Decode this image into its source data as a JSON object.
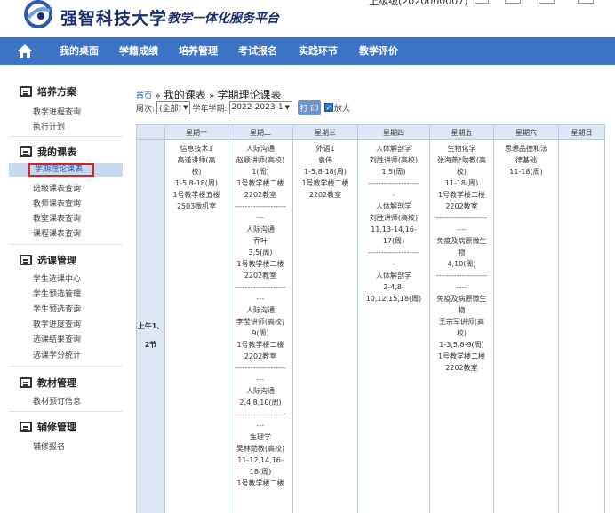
{
  "header": {
    "school_name": "强智科技大学",
    "platform_name": "教学一体化服务平台",
    "user_info": "上级级(2020000007)"
  },
  "nav": {
    "items": [
      "我的桌面",
      "学籍成绩",
      "培养管理",
      "考试报名",
      "实践环节",
      "教学评价"
    ]
  },
  "sidebar": {
    "sections": [
      {
        "title": "培养方案",
        "items": [
          "教学进程查询",
          "执行计划"
        ]
      },
      {
        "title": "我的课表",
        "items": [
          "学期理论课表",
          "班级课表查询",
          "教师课表查询",
          "教室课表查询",
          "课程课表查询"
        ]
      },
      {
        "title": "选课管理",
        "items": [
          "学生选课中心",
          "学生预选管理",
          "学生预选查询",
          "教学进度查询",
          "选课结果查询",
          "选课学分统计"
        ]
      },
      {
        "title": "教材管理",
        "items": [
          "教材预订信息"
        ]
      },
      {
        "title": "辅修管理",
        "items": [
          "辅修报名"
        ]
      }
    ]
  },
  "breadcrumb": {
    "home": "首页",
    "sep": "»",
    "level1": "我的课表",
    "level2": "学期理论课表"
  },
  "filters": {
    "week_label": "周次:",
    "week_value": "(全部)",
    "term_label": "学年学期:",
    "term_value": "2022-2023-1",
    "print_label": "打 印",
    "zoom_label": "放大"
  },
  "timetable": {
    "days": [
      "星期一",
      "星期二",
      "星期三",
      "星期四",
      "星期五",
      "星期六",
      "星期日"
    ],
    "period_label_1": "上午1、",
    "period_label_2": "2节",
    "monday": [
      "信息技术1",
      "高谨讲师(高",
      "校)",
      "1-5,8-18(周)",
      "1号教学楼五楼",
      "2503微机室"
    ],
    "tuesday": [
      "人际沟通",
      "赵颖讲师(高校)",
      "1(周)",
      "1号教学楼二楼",
      "2202教室",
      "--------------------",
      "---",
      "人际沟通",
      "乔叶",
      "3,5(周)",
      "1号教学楼二楼",
      "2202教室",
      "--------------------",
      "---",
      "人际沟通",
      "李莹讲师(高校)",
      "9(周)",
      "1号教学楼二楼",
      "2202教室",
      "--------------------",
      "---",
      "人际沟通",
      "2,4,8,10(周)",
      "--------------------",
      "---",
      "生理学",
      "吴林助教(高校)",
      "11-12,14,16-",
      "18(周)",
      "1号教学楼二楼"
    ],
    "wednesday": [
      "外语1",
      "袁伟",
      "1-5,8-18(周)",
      "1号教学楼二楼",
      "2202教室"
    ],
    "thursday": [
      "人体解剖学",
      "刘胜讲师(高校)",
      "1,5(周)",
      "--------------------",
      "-",
      "人体解剖学",
      "刘胜讲师(高校)",
      "11,13-14,16-",
      "17(周)",
      "--------------------",
      "-",
      "人体解剖学",
      "2-4,8-",
      "10,12,15,18(周)"
    ],
    "friday": [
      "生物化学",
      "张海燕*助教(高",
      "校)",
      "11-18(周)",
      "1号教学楼二楼",
      "2202教室",
      "--------------------",
      "----",
      "免疫及病原微生",
      "物",
      "4,10(周)",
      "--------------------",
      "----",
      "免疫及病原微生",
      "物",
      "王宗军讲师(高",
      "校)",
      "1-3,5,8-9(周)",
      "1号教学楼二楼",
      "2202教室"
    ],
    "saturday": [
      "思想品德和法",
      "律基础",
      "11-18(周)"
    ],
    "sunday": []
  },
  "colors": {
    "nav_bg": "#3c73c4",
    "header_bg": "#dde7f6",
    "active_outline": "#e02020",
    "link": "#1a56b0"
  }
}
